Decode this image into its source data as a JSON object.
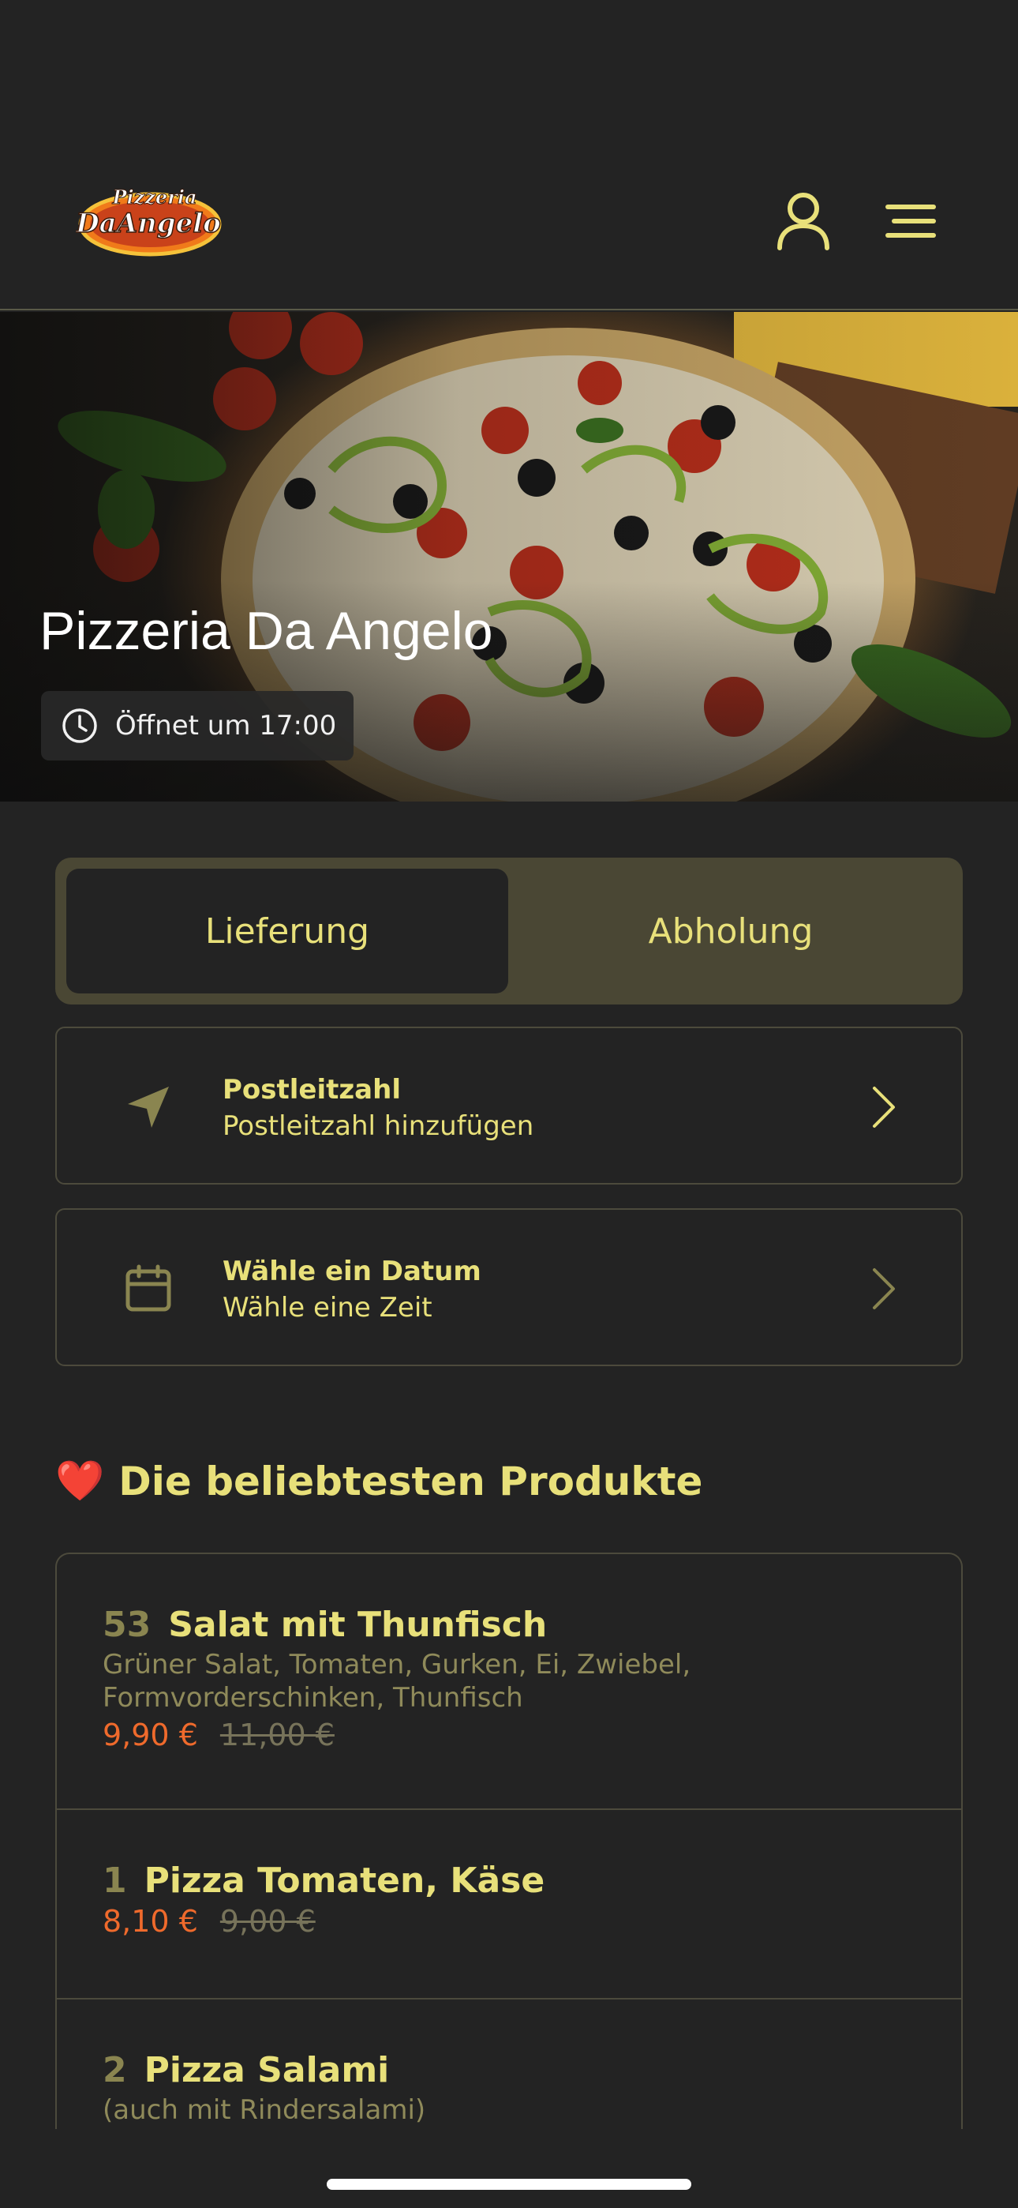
{
  "header": {
    "logo_text_top": "Pizzeria",
    "logo_text_main": "DaAngelo",
    "icons": [
      "user-icon",
      "hamburger-menu-icon"
    ]
  },
  "hero": {
    "title": "Pizzeria Da Angelo",
    "open_status": "Öffnet um 17:00"
  },
  "mode_toggle": {
    "options": [
      "Lieferung",
      "Abholung"
    ],
    "selected": "Lieferung"
  },
  "postcode_card": {
    "title": "Postleitzahl",
    "subtitle": "Postleitzahl hinzufügen"
  },
  "date_card": {
    "title": "Wähle ein Datum",
    "subtitle": "Wähle eine Zeit"
  },
  "popular": {
    "emoji": "❤️",
    "title": "Die beliebtesten Produkte",
    "products": [
      {
        "number": "53",
        "name": "Salat mit Thunfisch",
        "desc_line1": "Grüner Salat, Tomaten, Gurken, Ei, Zwiebel,",
        "desc_line2": "Formvorderschinken, Thunfisch",
        "price": "9,90 €",
        "old_price": "11,00 €"
      },
      {
        "number": "1",
        "name": "Pizza Tomaten, Käse",
        "price": "8,10 €",
        "old_price": "9,00 €"
      },
      {
        "number": "2",
        "name": "Pizza Salami",
        "desc_line1": "(auch mit Rindersalami)"
      }
    ]
  },
  "colors": {
    "background": "#232323",
    "accent": "#e8e07a",
    "price": "#ef6a2c",
    "toggle_bg": "#4a4734"
  }
}
